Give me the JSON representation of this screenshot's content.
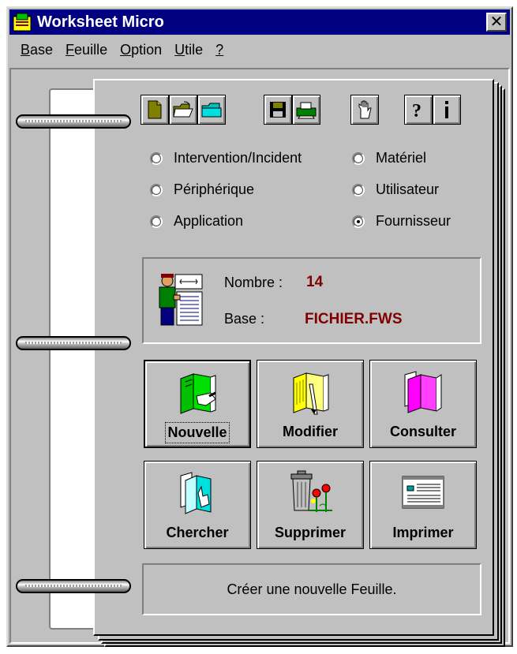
{
  "window": {
    "title": "Worksheet Micro",
    "close_label": "✕"
  },
  "menu": [
    {
      "label": "Base"
    },
    {
      "label": "Feuille"
    },
    {
      "label": "Option"
    },
    {
      "label": "Utile"
    },
    {
      "label": "?"
    }
  ],
  "toolbar": [
    {
      "icon": "new-document-icon"
    },
    {
      "icon": "open-folder-icon"
    },
    {
      "icon": "folder-icon"
    },
    {
      "icon": "save-disk-icon"
    },
    {
      "icon": "printer-icon"
    },
    {
      "icon": "hand-icon"
    },
    {
      "icon": "help-icon"
    },
    {
      "icon": "info-icon"
    }
  ],
  "radios": [
    {
      "label": "Intervention/Incident",
      "checked": false
    },
    {
      "label": "Matériel",
      "checked": false
    },
    {
      "label": "Périphérique",
      "checked": false
    },
    {
      "label": "Utilisateur",
      "checked": false
    },
    {
      "label": "Application",
      "checked": false
    },
    {
      "label": "Fournisseur",
      "checked": true
    }
  ],
  "info": {
    "count_label": "Nombre :",
    "count_value": "14",
    "base_label": "Base :",
    "base_value": "FICHIER.FWS",
    "value_color": "#800000"
  },
  "actions": [
    {
      "label": "Nouvelle",
      "icon": "new-sheet-icon",
      "default": true
    },
    {
      "label": "Modifier",
      "icon": "edit-sheet-icon"
    },
    {
      "label": "Consulter",
      "icon": "view-sheet-icon"
    },
    {
      "label": "Chercher",
      "icon": "search-sheet-icon"
    },
    {
      "label": "Supprimer",
      "icon": "trash-icon"
    },
    {
      "label": "Imprimer",
      "icon": "print-icon"
    }
  ],
  "status": {
    "text": "Créer une nouvelle Feuille."
  },
  "colors": {
    "titlebar": "#000080",
    "face": "#c0c0c0"
  }
}
